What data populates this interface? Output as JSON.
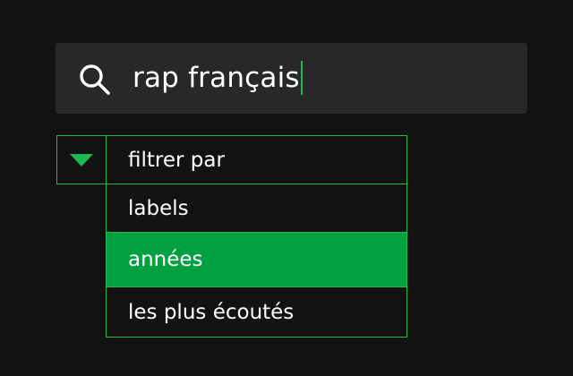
{
  "search": {
    "query": "rap français",
    "icon": "search-icon"
  },
  "filter": {
    "toggle_icon": "triangle-down-icon",
    "header_label": "filtrer par",
    "options": [
      {
        "label": "labels",
        "selected": false
      },
      {
        "label": "années",
        "selected": true
      },
      {
        "label": "les plus écoutés",
        "selected": false
      }
    ]
  },
  "colors": {
    "background": "#121212",
    "search_field": "#282828",
    "accent": "#1db954",
    "selected_row": "#00a040",
    "text": "#ffffff"
  }
}
